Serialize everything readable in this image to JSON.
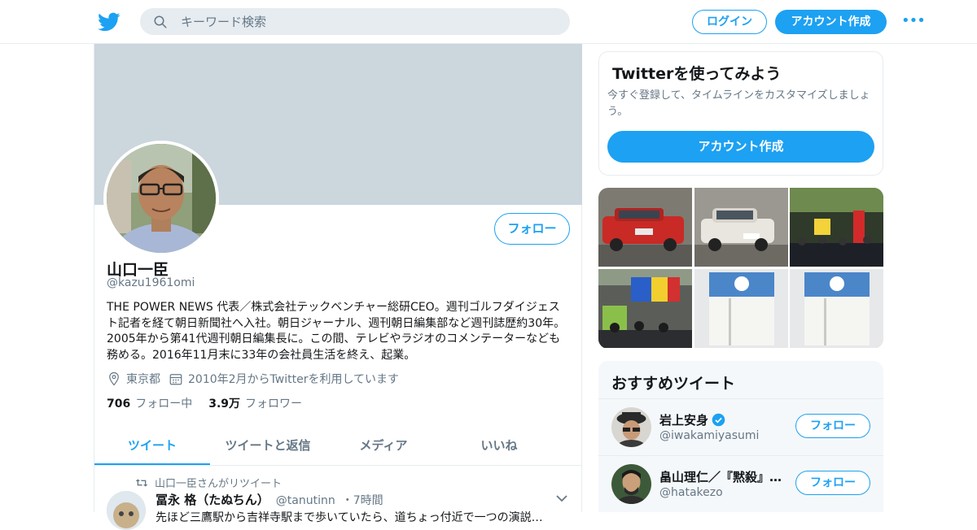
{
  "header": {
    "search_placeholder": "キーワード検索",
    "login_label": "ログイン",
    "signup_label": "アカウント作成",
    "more_glyph": "•••"
  },
  "profile": {
    "name": "山口一臣",
    "handle": "@kazu1961omi",
    "follow_label": "フォロー",
    "bio": "THE POWER NEWS 代表／株式会社テックベンチャー総研CEO。週刊ゴルフダイジェスト記者を経て朝日新聞社へ入社。朝日ジャーナル、週刊朝日編集部など週刊誌歴約30年。2005年から第41代週刊朝日編集長に。この間、テレビやラジオのコメンテーターなども務める。2016年11月末に33年の会社員生活を終え、起業。",
    "location": "東京都",
    "joined": "2010年2月からTwitterを利用しています",
    "following_count": "706",
    "following_label": "フォロー中",
    "followers_count": "3.9万",
    "followers_label": "フォロワー"
  },
  "tabs": [
    {
      "label": "ツイート",
      "active": true
    },
    {
      "label": "ツイートと返信",
      "active": false
    },
    {
      "label": "メディア",
      "active": false
    },
    {
      "label": "いいね",
      "active": false
    }
  ],
  "tweet": {
    "retweet_note": "山口一臣さんがリツイート",
    "author_name": "冨永 格（たぬちん）",
    "author_handle": "@tanutinn",
    "time": "・7時間",
    "text": "先ほど三鷹駅から吉祥寺駅まで歩いていたら、道ちょっ付近で一つの演説…"
  },
  "signup_card": {
    "title": "Twitterを使ってみよう",
    "body": "今すぐ登録して、タイムラインをカスタマイズしましょう。",
    "cta": "アカウント作成"
  },
  "recommend": {
    "title": "おすすめツイート",
    "users": [
      {
        "name": "岩上安身",
        "handle": "@iwakamiyasumi",
        "verified": true,
        "follow_label": "フォロー"
      },
      {
        "name": "畠山理仁／『黙殺』…",
        "handle": "@hatakezo",
        "verified": false,
        "follow_label": "フォロー"
      }
    ]
  },
  "colors": {
    "accent": "#1da1f2",
    "banner": "#ccd6dd",
    "muted": "#657786"
  },
  "icons": [
    "twitter-bird-icon",
    "search-icon",
    "location-pin-icon",
    "calendar-icon",
    "retweet-icon",
    "chevron-down-icon",
    "verified-badge-icon"
  ]
}
